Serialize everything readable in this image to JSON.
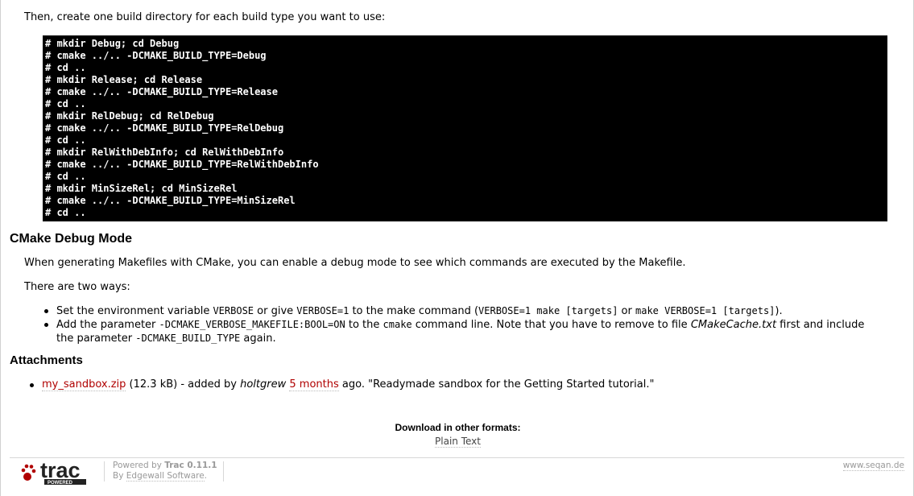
{
  "intro": "Then, create one build directory for each build type you want to use:",
  "code_lines": [
    "# mkdir Debug; cd Debug",
    "# cmake ../.. -DCMAKE_BUILD_TYPE=Debug",
    "# cd ..",
    "# mkdir Release; cd Release",
    "# cmake ../.. -DCMAKE_BUILD_TYPE=Release",
    "# cd ..",
    "# mkdir RelDebug; cd RelDebug",
    "# cmake ../.. -DCMAKE_BUILD_TYPE=RelDebug",
    "# cd ..",
    "# mkdir RelWithDebInfo; cd RelWithDebInfo",
    "# cmake ../.. -DCMAKE_BUILD_TYPE=RelWithDebInfo",
    "# cd ..",
    "# mkdir MinSizeRel; cd MinSizeRel",
    "# cmake ../.. -DCMAKE_BUILD_TYPE=MinSizeRel",
    "# cd .."
  ],
  "debug": {
    "heading": "CMake Debug Mode",
    "para1": "When generating Makefiles with CMake, you can enable a debug mode to see which commands are executed by the Makefile.",
    "para2": "There are two ways:",
    "item1": {
      "t1": "Set the environment variable ",
      "c1": "VERBOSE",
      "t2": " or give ",
      "c2": "VERBOSE=1",
      "t3": " to the make command (",
      "c3": "VERBOSE=1 make [targets]",
      "t4": " or ",
      "c4": "make VERBOSE=1 [targets]",
      "t5": ")."
    },
    "item2": {
      "t1": "Add the parameter ",
      "c1": "-DCMAKE_VERBOSE_MAKEFILE:BOOL=ON",
      "t2": " to the ",
      "c2": "cmake",
      "t3": " command line. Note that you have to remove to file ",
      "e1": "CMakeCache.txt",
      "t4": " first and include the parameter ",
      "c3": "-DCMAKE_BUILD_TYPE",
      "t5": " again."
    }
  },
  "attachments": {
    "heading": "Attachments",
    "file_link": "my_sandbox.zip",
    "size": " (12.3 kB) - added by ",
    "author": "holtgrew",
    "space": " ",
    "age_link": "5 months",
    "description": " ago. \"Readymade sandbox for the Getting Started tutorial.\""
  },
  "download": {
    "title": "Download in other formats:",
    "plain_text": "Plain Text"
  },
  "footer": {
    "logo_word": "trac",
    "logo_sub": "POWERED",
    "powered_by": "Powered by ",
    "trac_version": "Trac 0.11.1",
    "by": "By ",
    "edgewall": "Edgewall Software",
    "period": ".",
    "site": "www.seqan.de"
  },
  "colors": {
    "link": "#b00000",
    "code_bg": "#000000",
    "footer_text": "#999999"
  }
}
